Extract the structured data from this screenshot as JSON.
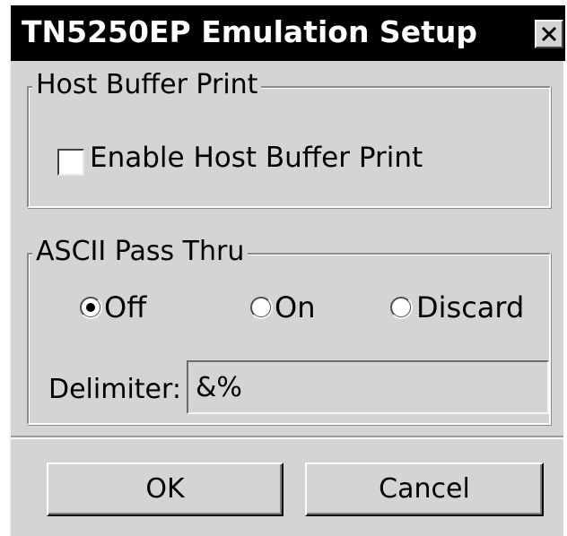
{
  "window": {
    "title": "TN5250EP Emulation Setup",
    "close_icon": "close-x-icon"
  },
  "host_buffer_print": {
    "legend": "Host Buffer Print",
    "checkbox_label": "Enable Host Buffer Print",
    "checked": false
  },
  "ascii_pass_thru": {
    "legend": "ASCII Pass Thru",
    "options": [
      {
        "label": "Off",
        "selected": true
      },
      {
        "label": "On",
        "selected": false
      },
      {
        "label": "Discard",
        "selected": false
      }
    ],
    "delimiter_label": "Delimiter:",
    "delimiter_value": "&%"
  },
  "buttons": {
    "ok_label": "OK",
    "cancel_label": "Cancel"
  },
  "colors": {
    "dialog_bg": "#d4d4d4",
    "title_bar_bg": "#000000",
    "title_text": "#ffffff"
  }
}
